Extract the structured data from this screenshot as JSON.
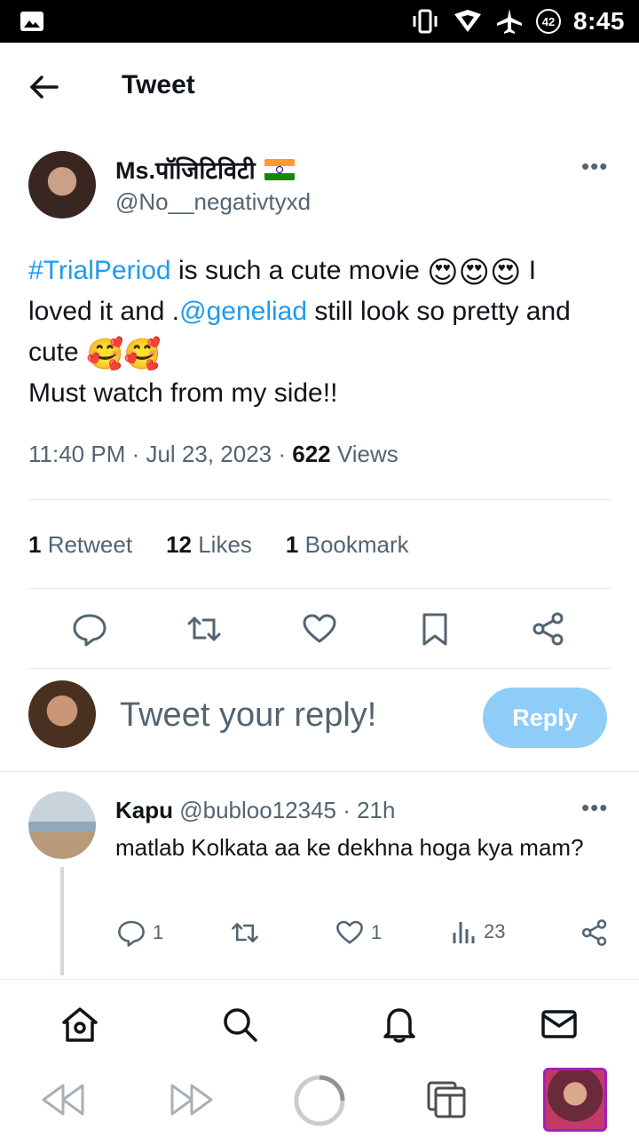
{
  "status_bar": {
    "time": "8:45",
    "battery": "42"
  },
  "header": {
    "title": "Tweet"
  },
  "tweet": {
    "author_name": "Ms.पॉजिटिविटी",
    "author_handle": "@No__negativtyxd",
    "text": {
      "hashtag": "#TrialPeriod",
      "seg1": " is such a cute movie ",
      "emoji_heart_eyes": "😍😍😍",
      "seg2": " I loved it and .",
      "mention": "@geneliad",
      "seg3": " still look so pretty and cute ",
      "emoji_smile_hearts": "🥰🥰",
      "line2": "Must watch from my side!!"
    },
    "timestamp": "11:40 PM · Jul 23, 2023 · ",
    "views_count": "622",
    "views_label": " Views",
    "stats": {
      "retweets_count": "1",
      "retweets_label": " Retweet",
      "likes_count": "12",
      "likes_label": " Likes",
      "bookmarks_count": "1",
      "bookmarks_label": " Bookmark"
    }
  },
  "composer": {
    "placeholder": "Tweet your reply!",
    "reply_button": "Reply"
  },
  "reply": {
    "name": "Kapu",
    "handle_time": " @bubloo12345 · 21h",
    "text": "matlab Kolkata aa ke dekhna hoga kya mam?",
    "replies": "1",
    "likes": "1",
    "views": "23"
  },
  "colors": {
    "accent": "#1d9bf0",
    "reply_button": "#8ecdf7",
    "muted": "#536471"
  }
}
